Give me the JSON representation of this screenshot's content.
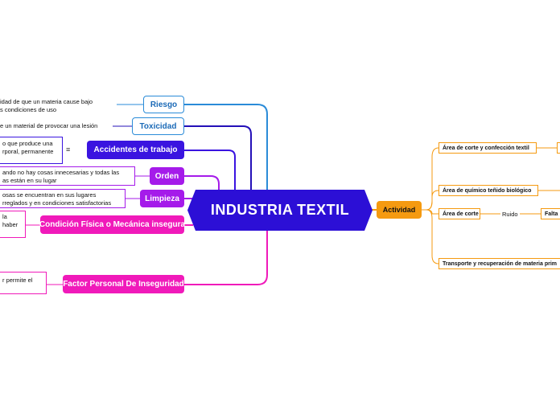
{
  "central": {
    "title": "INDUSTRIA TEXTIL"
  },
  "left_branches": [
    {
      "label": "Riesgo",
      "note": [
        "idad de que un materia cause bajo",
        "s condiciones de uso"
      ]
    },
    {
      "label": "Toxicidad",
      "note": [
        "e un material de provocar una lesión"
      ]
    },
    {
      "label": "Accidentes de trabajo",
      "note": [
        "o que produce una",
        "rporal, permanente"
      ]
    },
    {
      "label": "Orden",
      "note": [
        "ando no hay cosas innecesarias y todas las",
        "as están en su lugar"
      ]
    },
    {
      "label": "Limpieza",
      "note": [
        "osas se encuentran en sus lugares",
        "rreglados y en condiciones satisfactorias"
      ]
    },
    {
      "label": "Condición Física o Mecánica insegura",
      "note": [
        "la",
        "haber"
      ]
    },
    {
      "label": "Factor Personal De Inseguridad",
      "note": [
        "r permite el"
      ]
    }
  ],
  "right": {
    "label": "Actividad",
    "items": [
      {
        "label": "Área de corte y confección textil"
      },
      {
        "label": "Área de químico teñido biológico"
      },
      {
        "label": "Área de corte",
        "relation": "Ruido",
        "target": "Falta"
      },
      {
        "label": "Transporte y recuperación de materia prim"
      }
    ]
  },
  "icons": {
    "notes_icon": "≡"
  },
  "colors": {
    "central": "#2c0fd6",
    "riesgo": "#2a8bd8",
    "accidentes": "#3a14e0",
    "orden": "#a51bea",
    "condicion": "#f01aba",
    "actividad": "#f59a10"
  }
}
